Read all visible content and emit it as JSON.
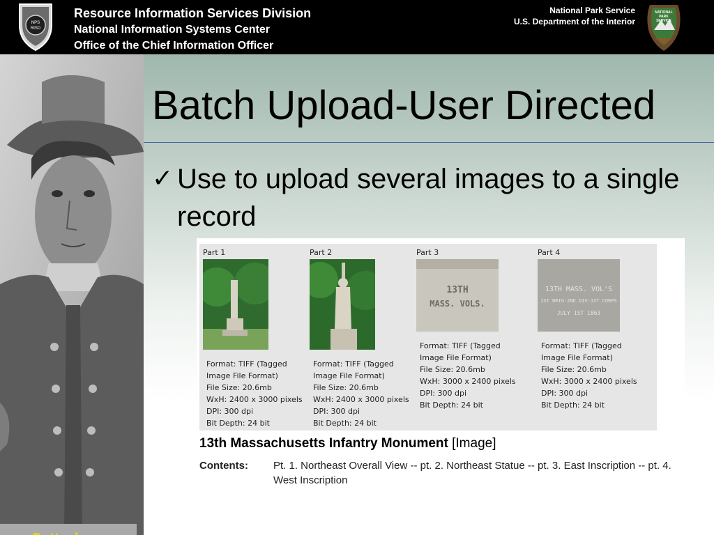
{
  "header": {
    "division": "Resource Information Services Division",
    "center": "National Information Systems Center",
    "office": "Office of the Chief Information Officer",
    "agency": "National Park Service",
    "department": "U.S. Department of the Interior",
    "shield_text_top": "NPS",
    "shield_text_bottom": "RISD",
    "arrowhead_text_1": "NATIONAL",
    "arrowhead_text_2": "PARK",
    "arrowhead_text_3": "SERVICE"
  },
  "sidebar": {
    "caption": "Gettysburg"
  },
  "slide": {
    "title": "Batch Upload-User Directed",
    "bullet_mark": "✓",
    "bullet": "Use to upload several images to a single record"
  },
  "record": {
    "parts": [
      {
        "label": "Part 1",
        "info": [
          "Format: TIFF (Tagged",
          "Image File Format)",
          "File Size: 20.6mb",
          "WxH: 2400 x 3000 pixels",
          "DPI: 300 dpi",
          "Bit Depth: 24 bit"
        ]
      },
      {
        "label": "Part 2",
        "info": [
          "Format: TIFF (Tagged",
          "Image File Format)",
          "File Size: 20.6mb",
          "WxH: 2400 x 3000 pixels",
          "DPI: 300 dpi",
          "Bit Depth: 24 bit"
        ]
      },
      {
        "label": "Part 3",
        "inscription_1": "13TH",
        "inscription_2": "MASS. VOLS.",
        "info": [
          "Format: TIFF (Tagged",
          "Image File Format)",
          "File Size: 20.6mb",
          "WxH: 3000 x 2400 pixels",
          "DPI: 300 dpi",
          "Bit Depth: 24 bit"
        ]
      },
      {
        "label": "Part 4",
        "inscription_1": "13TH MASS. VOL'S",
        "inscription_2": "1ST BRIG-2ND DIV-1ST CORPS",
        "inscription_3": "JULY 1ST 1863",
        "info": [
          "Format: TIFF (Tagged",
          "Image File Format)",
          "File Size: 20.6mb",
          "WxH: 3000 x 2400 pixels",
          "DPI: 300 dpi",
          "Bit Depth: 24 bit"
        ]
      }
    ],
    "title": "13th Massachusetts Infantry Monument",
    "title_tag": "[Image]",
    "contents_label": "Contents:",
    "contents_value": "Pt. 1. Northeast Overall View -- pt. 2. Northeast Statue -- pt. 3. East Inscription -- pt. 4. West Inscription"
  },
  "colors": {
    "header_bg": "#000000",
    "caption_text": "#f2d300",
    "title_rule": "#4a63a3"
  }
}
